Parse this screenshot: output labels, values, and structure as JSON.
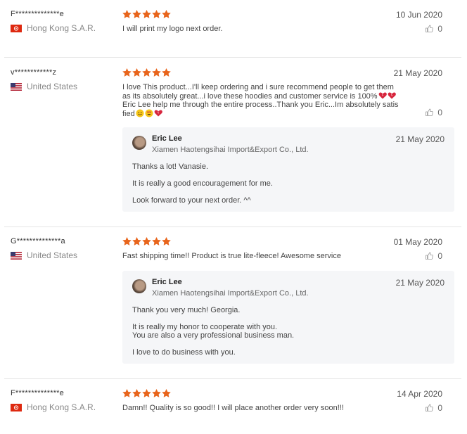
{
  "colors": {
    "star": "#e8651c",
    "divider": "#e5e5e5",
    "reply_bg": "#f5f6f8"
  },
  "reviews": [
    {
      "user": "F**************e",
      "country": "Hong Kong S.A.R.",
      "flag": "hong-kong-flag",
      "rating": 5,
      "date": "10 Jun 2020",
      "comment": "I will print my logo next order.",
      "likes": "0"
    },
    {
      "user": "v************z",
      "country": "United States",
      "flag": "united-states-flag",
      "rating": 5,
      "date": "21 May 2020",
      "comment": "I love This product...I'll keep ordering and i sure recommend people to get them as its absolutely great...i love these hoodies and customer service is 100%",
      "comment_mid": "Eric Lee help me through the entire process..Thank you Eric...Im absolutely satisfied",
      "likes": "0",
      "reply": {
        "author": "Eric Lee",
        "company": "Xiamen Haotengsihai Import&Export Co., Ltd.",
        "date": "21 May 2020",
        "lines": [
          "Thanks a lot! Vanasie.",
          "It is really a good encouragement for me.",
          "Look forward to your next order. ^^"
        ]
      }
    },
    {
      "user": "G**************a",
      "country": "United States",
      "flag": "united-states-flag",
      "rating": 5,
      "date": "01 May 2020",
      "comment": "Fast shipping time!! Product is true lite-fleece! Awesome service",
      "likes": "0",
      "reply": {
        "author": "Eric Lee",
        "company": "Xiamen Haotengsihai Import&Export Co., Ltd.",
        "date": "21 May 2020",
        "lines": [
          "Thank you very much! Georgia.",
          "It is really my honor to cooperate with you.",
          "You are also a very professional business man.",
          "I love to do business with you."
        ]
      }
    },
    {
      "user": "F**************e",
      "country": "Hong Kong S.A.R.",
      "flag": "hong-kong-flag",
      "rating": 5,
      "date": "14 Apr 2020",
      "comment": "Damn!! Quality is so good!! I will place another order very soon!!!",
      "likes": "0"
    }
  ]
}
